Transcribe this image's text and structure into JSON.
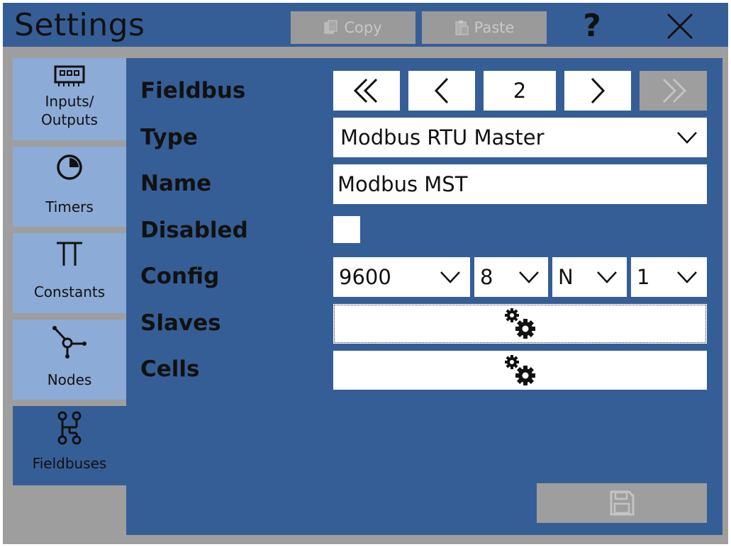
{
  "header": {
    "title": "Settings",
    "copy_label": "Copy",
    "paste_label": "Paste",
    "help_label": "?"
  },
  "sidebar": {
    "items": [
      {
        "label_line1": "Inputs/",
        "label_line2": "Outputs",
        "icon": "io-module-icon",
        "active": false
      },
      {
        "label": "Timers",
        "icon": "timer-icon",
        "active": false
      },
      {
        "label": "Constants",
        "icon": "pi-constant-icon",
        "active": false
      },
      {
        "label": "Nodes",
        "icon": "node-icon",
        "active": false
      },
      {
        "label": "Fieldbuses",
        "icon": "fieldbus-icon",
        "active": true
      }
    ]
  },
  "form": {
    "fieldbus_label": "Fieldbus",
    "type_label": "Type",
    "name_label": "Name",
    "disabled_label": "Disabled",
    "config_label": "Config",
    "slaves_label": "Slaves",
    "cells_label": "Cells",
    "fieldbus_index": "2",
    "type_value": "Modbus RTU Master",
    "name_value": "Modbus MST",
    "disabled_checked": false,
    "config": {
      "baud": "9600",
      "data_bits": "8",
      "parity": "N",
      "stop_bits": "1"
    }
  },
  "colors": {
    "accent": "#365e96",
    "sidebar_inactive": "#8cabd6",
    "disabled_gray": "#9e9e9e"
  }
}
